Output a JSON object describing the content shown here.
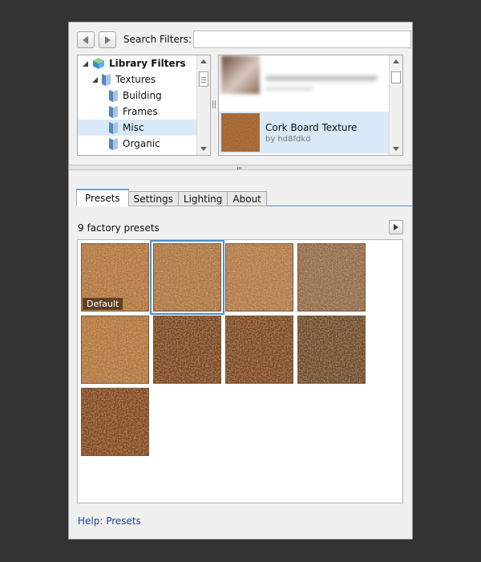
{
  "search": {
    "label": "Search Filters:",
    "value": "",
    "placeholder": ""
  },
  "tree": {
    "items": [
      {
        "label": "Library Filters",
        "level": 0,
        "expanded": true,
        "icon": "library-cube-icon"
      },
      {
        "label": "Textures",
        "level": 1,
        "expanded": true,
        "icon": "folder-icon"
      },
      {
        "label": "Building",
        "level": 2,
        "icon": "folder-icon"
      },
      {
        "label": "Frames",
        "level": 2,
        "icon": "folder-icon"
      },
      {
        "label": "Misc",
        "level": 2,
        "icon": "folder-icon",
        "selected": true
      },
      {
        "label": "Organic",
        "level": 2,
        "icon": "folder-icon"
      }
    ]
  },
  "list": {
    "items": [
      {
        "title": "",
        "subtitle": "",
        "blurred": true
      },
      {
        "title": "Cork Board Texture",
        "subtitle": "by hd8fdkd",
        "selected": true
      }
    ]
  },
  "tabs": [
    {
      "label": "Presets",
      "active": true
    },
    {
      "label": "Settings"
    },
    {
      "label": "Lighting"
    },
    {
      "label": "About"
    }
  ],
  "presets": {
    "count_label": "9 factory presets",
    "default_label": "Default",
    "selected_index": 1,
    "colors": [
      "#cc8a4c",
      "#c68950",
      "#cc8f58",
      "#a67c5c",
      "#cc8a48",
      "#8c4e24",
      "#8e5024",
      "#7a5232",
      "#94501e"
    ]
  },
  "help": {
    "label": "Help: Presets"
  },
  "colors": {
    "background": "#333333",
    "panel": "#f0f0f0",
    "selection": "#d9e9f8",
    "accent": "#4a90d0",
    "link": "#1f3f9a"
  }
}
